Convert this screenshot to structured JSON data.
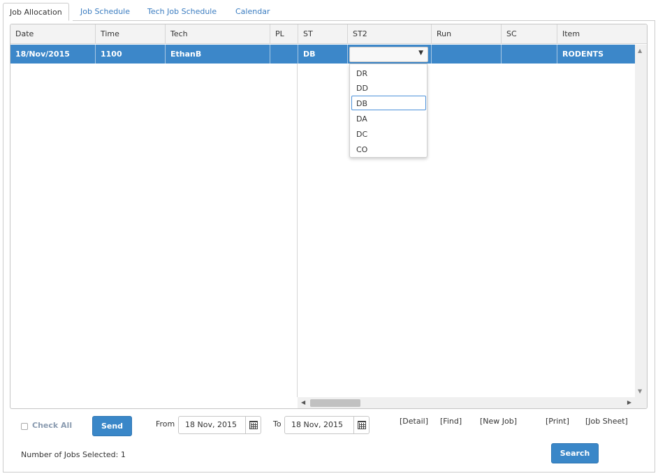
{
  "tabs": [
    "Job Allocation",
    "Job Schedule",
    "Tech Job Schedule",
    "Calendar"
  ],
  "grid": {
    "columns": [
      "Date",
      "Time",
      "Tech",
      "PL",
      "ST",
      "ST2",
      "Run",
      "SC",
      "Item"
    ],
    "rows": [
      {
        "date": "18/Nov/2015",
        "time": "1100",
        "tech": "EthanB",
        "pl": "",
        "st": "DB",
        "st2": "",
        "run": "",
        "sc": "",
        "item": "RODENTS"
      }
    ]
  },
  "st2_dropdown": {
    "options": [
      "DR",
      "DD",
      "DB",
      "DA",
      "DC",
      "CO"
    ],
    "highlighted": "DB"
  },
  "footer": {
    "check_all_label": "Check All",
    "send_label": "Send",
    "from_label": "From",
    "from_value": "18 Nov, 2015",
    "to_label": "To",
    "to_value": "18 Nov, 2015",
    "links": [
      "[Detail]",
      "[Find]",
      "[New Job]",
      "[Print]",
      "[Job Sheet]"
    ],
    "jobs_selected_text": "Number of Jobs Selected: 1",
    "search_label": "Search"
  },
  "colors": {
    "selected_row": "#3c87c9",
    "button": "#3a87c8",
    "tab_link": "#3a7cc0"
  }
}
